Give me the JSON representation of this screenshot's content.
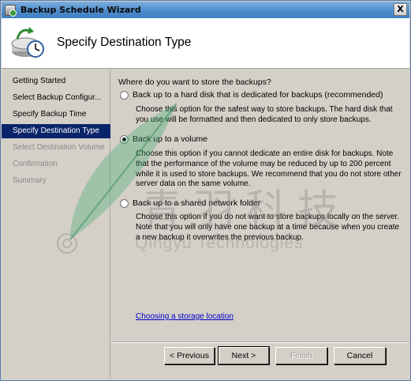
{
  "window": {
    "title": "Backup Schedule Wizard",
    "close_label": "X"
  },
  "header": {
    "title": "Specify Destination Type",
    "icon": "backup-clock-icon"
  },
  "steps": [
    {
      "label": "Getting Started",
      "state": "done"
    },
    {
      "label": "Select Backup Configur...",
      "state": "done"
    },
    {
      "label": "Specify Backup Time",
      "state": "done"
    },
    {
      "label": "Specify Destination Type",
      "state": "current"
    },
    {
      "label": "Select Destination Volume",
      "state": "future"
    },
    {
      "label": "Confirmation",
      "state": "future"
    },
    {
      "label": "Summary",
      "state": "future"
    }
  ],
  "content": {
    "question": "Where do you want to store the backups?",
    "options": [
      {
        "label": "Back up to a hard disk that is dedicated for backups (recommended)",
        "checked": false,
        "description": "Choose this option for the safest way to store backups. The hard disk that you use will be formatted and then dedicated to only store backups."
      },
      {
        "label": "Back up to a volume",
        "checked": true,
        "description": "Choose this option if you cannot dedicate an entire disk for backups. Note that the performance of the volume may be reduced by up to 200 percent while it is used to store backups. We recommend that you do not store other server data on the same volume."
      },
      {
        "label": "Back up to a shared network folder",
        "checked": false,
        "description": "Choose this option if you do not want to store backups locally on the server. Note that you will only have one backup at a time because when you create a new backup it overwrites the previous backup."
      }
    ],
    "link": "Choosing a storage location"
  },
  "buttons": {
    "previous": "< Previous",
    "next": "Next >",
    "finish": "Finish",
    "cancel": "Cancel"
  },
  "watermark": {
    "chinese": "青羽科技",
    "english": "Qingyu Technologies"
  },
  "colors": {
    "selection": "#0a246a",
    "link": "#0000c8",
    "dialog": "#d4d0c8"
  }
}
